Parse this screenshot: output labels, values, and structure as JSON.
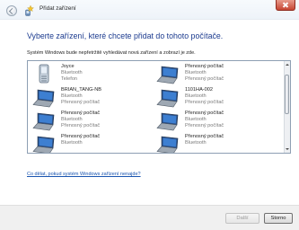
{
  "window": {
    "title": "Přidat zařízení",
    "back_icon": "back-arrow-icon",
    "close_icon": "close-icon"
  },
  "main": {
    "heading": "Vyberte zařízení, které chcete přidat do tohoto počítače.",
    "subtext": "Systém Windows bude nepřetržitě vyhledávat nová zařízení a zobrazí je zde."
  },
  "devices": [
    {
      "name": "Joyce",
      "line2": "Bluetooth",
      "line3": "Telefon",
      "icon": "phone-icon"
    },
    {
      "name": "Přenosný počítač",
      "line2": "Bluetooth",
      "line3": "Přenosný počítač",
      "icon": "laptop-icon"
    },
    {
      "name": "BRIAN_TANG-NB",
      "line2": "Bluetooth",
      "line3": "Přenosný počítač",
      "icon": "laptop-icon"
    },
    {
      "name": "1101HA-002",
      "line2": "Bluetooth",
      "line3": "Přenosný počítač",
      "icon": "laptop-icon"
    },
    {
      "name": "Přenosný počítač",
      "line2": "Bluetooth",
      "line3": "Přenosný počítač",
      "icon": "laptop-icon"
    },
    {
      "name": "Přenosný počítač",
      "line2": "Bluetooth",
      "line3": "Přenosný počítač",
      "icon": "laptop-icon"
    },
    {
      "name": "Přenosný počítač",
      "line2": "Bluetooth",
      "line3": "",
      "icon": "laptop-icon"
    },
    {
      "name": "Přenosný počítač",
      "line2": "Bluetooth",
      "line3": "",
      "icon": "laptop-icon"
    }
  ],
  "links": {
    "help": "Co dělat, pokud systém Windows zařízení nenajde?"
  },
  "buttons": {
    "next": "Další",
    "cancel": "Storno"
  },
  "colors": {
    "heading": "#1c3b8f",
    "link": "#1a55b0",
    "close": "#c64633"
  }
}
